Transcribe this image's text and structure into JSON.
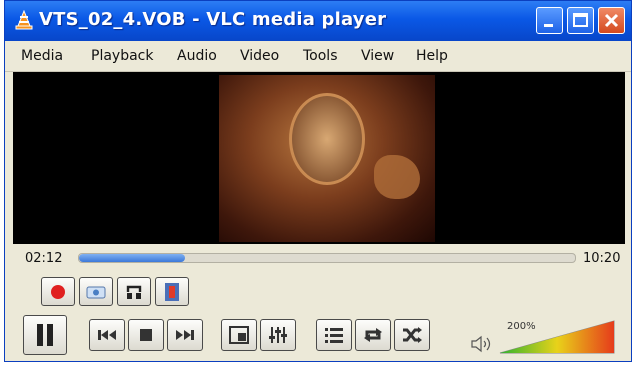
{
  "window": {
    "title": "VTS_02_4.VOB - VLC media player",
    "buttons": [
      "minimize",
      "maximize",
      "close"
    ]
  },
  "menu": {
    "items": [
      "Media",
      "Playback",
      "Audio",
      "Video",
      "Tools",
      "View",
      "Help"
    ]
  },
  "playback": {
    "elapsed": "02:12",
    "total": "10:20",
    "progress": 0.213
  },
  "volume": {
    "label": "200%",
    "level": 1.0
  },
  "colors": {
    "titlebar": "#0a58e6",
    "seek_fill": "#3c78d9",
    "record": "#e02020",
    "volume_low": "#2fb32f",
    "volume_high": "#e63b1b"
  },
  "icons": {
    "record": "record-icon",
    "snapshot": "snapshot-icon",
    "loop_ab": "loop-ab-icon",
    "frame_step": "frame-by-frame-icon",
    "pause": "pause-icon",
    "previous": "previous-icon",
    "stop": "stop-icon",
    "next": "next-icon",
    "fullscreen": "fullscreen-icon",
    "extended": "extended-settings-icon",
    "playlist": "playlist-icon",
    "loop": "loop-icon",
    "shuffle": "shuffle-icon",
    "speaker": "speaker-icon"
  }
}
